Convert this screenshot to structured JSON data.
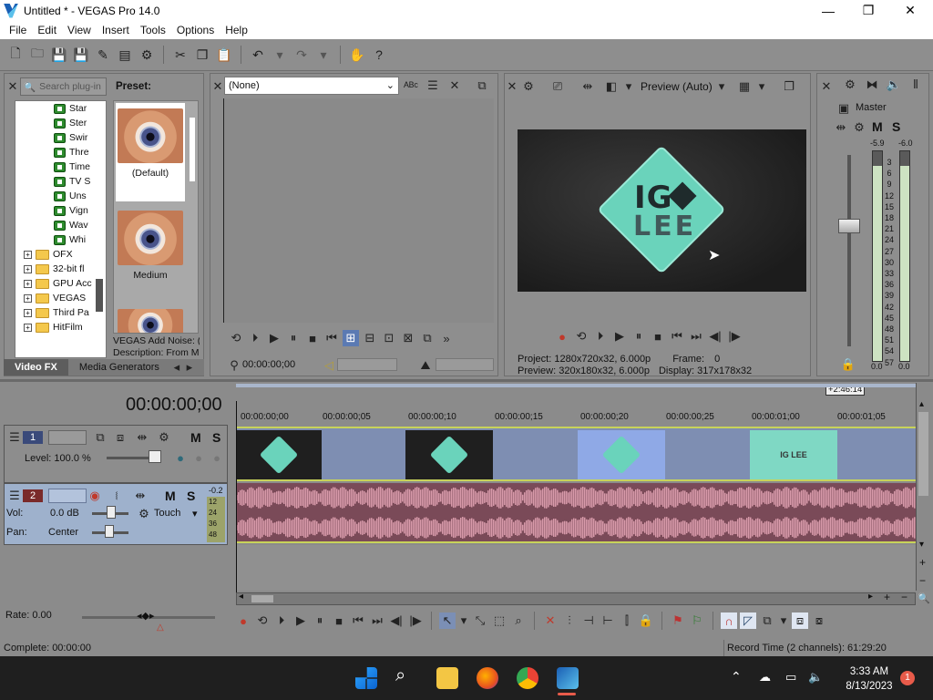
{
  "window": {
    "title": "Untitled * - VEGAS Pro 14.0",
    "minimize": "—",
    "maximize": "❐",
    "close": "✕"
  },
  "menu": [
    "File",
    "Edit",
    "View",
    "Insert",
    "Tools",
    "Options",
    "Help"
  ],
  "fx_browser": {
    "search_placeholder": "Search plug-in",
    "preset_label": "Preset:",
    "tree_plugins": [
      "Star",
      "Ster",
      "Swir",
      "Thre",
      "Time",
      "TV S",
      "Uns",
      "Vign",
      "Wav",
      "Whi"
    ],
    "tree_folders": [
      "OFX",
      "32-bit fl",
      "GPU Acc",
      "VEGAS",
      "Third Pa",
      "HitFilm"
    ],
    "presets": [
      "(Default)",
      "Medium"
    ],
    "desc_line1": "VEGAS Add Noise: (",
    "desc_line2": "Description: From M",
    "tabs": [
      "Video FX",
      "Media Generators"
    ]
  },
  "trimmer": {
    "select_value": "(None)",
    "time": "00:00:00;00"
  },
  "preview": {
    "mode": "Preview (Auto)",
    "logo_line1": "IG",
    "logo_line2": "LEE",
    "project_label": "Project:",
    "project_value": "1280x720x32, 6.000p",
    "preview_label": "Preview:",
    "preview_value": "320x180x32, 6.000p",
    "frame_label": "Frame:",
    "frame_value": "0",
    "display_label": "Display:",
    "display_value": "317x178x32"
  },
  "mixer": {
    "master": "Master",
    "peak_left": "-5.9",
    "peak_right": "-6.0",
    "scale": [
      "3",
      "6",
      "9",
      "12",
      "15",
      "18",
      "21",
      "24",
      "27",
      "30",
      "33",
      "36",
      "39",
      "42",
      "45",
      "48",
      "51",
      "54",
      "57"
    ],
    "bottom_left": "0.0",
    "bottom_right": "0.0",
    "level_left": 0.93,
    "level_right": 0.93
  },
  "timeline": {
    "time_display": "00:00:00;00",
    "end_marker": "+2:46:14",
    "ruler": [
      "00:00:00;00",
      "00:00:00;05",
      "00:00:00;10",
      "00:00:00;15",
      "00:00:00;20",
      "00:00:00;25",
      "00:00:01;00",
      "00:00:01;05"
    ],
    "video_track": {
      "number": "1",
      "level_label": "Level: 100.0 %"
    },
    "audio_track": {
      "number": "2",
      "vol_label": "Vol:",
      "vol_value": "0.0 dB",
      "pan_label": "Pan:",
      "pan_value": "Center",
      "automation": "Touch",
      "peak": "-0.2",
      "meter_nums": [
        "12",
        "24",
        "36",
        "48"
      ]
    },
    "clip_text": "IG LEE",
    "rate": "Rate: 0.00",
    "status_left": "Complete: 00:00:00",
    "status_right": "Record Time (2 channels): 61:29:20"
  },
  "taskbar": {
    "time": "3:33 AM",
    "date": "8/13/2023",
    "notifications": "1"
  },
  "colors": {
    "accent": "#6ad3bb",
    "clip_bg": "#7e8eb2",
    "audio_bg": "#7a4a58",
    "track_border": "#c8d35a"
  }
}
